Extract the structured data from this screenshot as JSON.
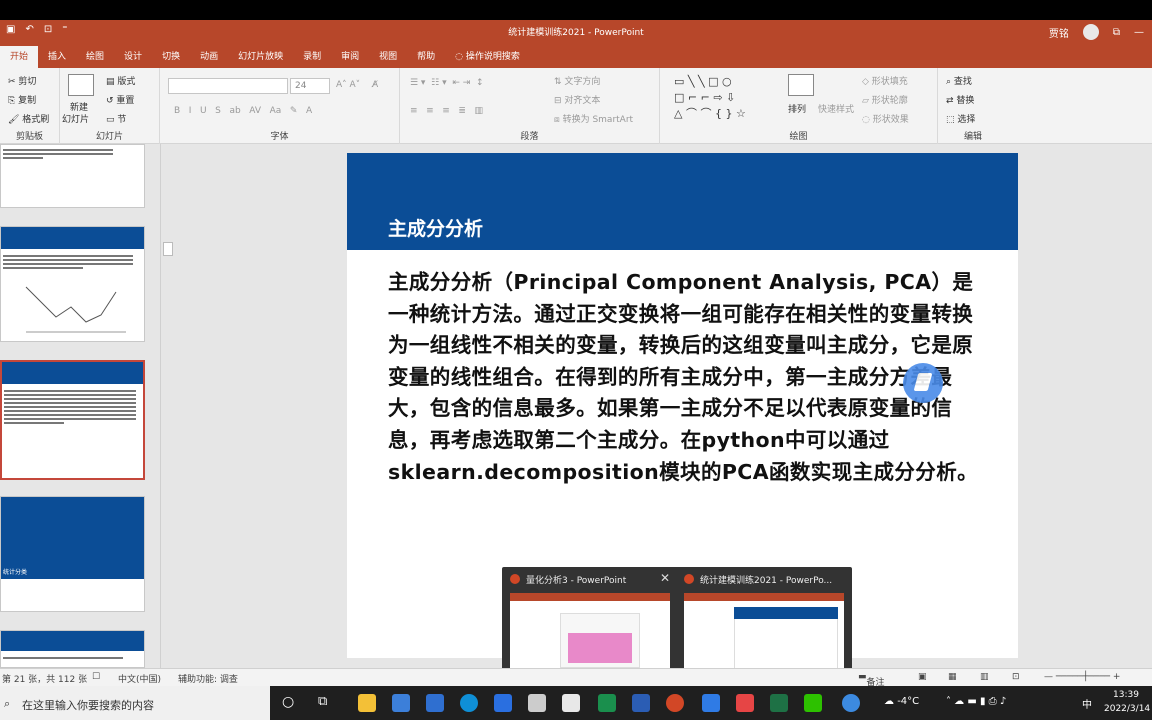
{
  "app": {
    "window_title": "统计建模训练2021 - PowerPoint",
    "user_name": "贾铭",
    "colors": {
      "ribbon_accent": "#b7472a",
      "slide_band": "#0b4d96"
    }
  },
  "tabs": [
    "开始",
    "插入",
    "绘图",
    "设计",
    "切换",
    "动画",
    "幻灯片放映",
    "录制",
    "审阅",
    "视图",
    "帮助",
    "操作说明搜索"
  ],
  "ribbon": {
    "clipboard": {
      "cut": "剪切",
      "copy": "复制",
      "format_painter": "格式刷",
      "label": "剪贴板"
    },
    "slides": {
      "new_slide_l1": "新建",
      "new_slide_l2": "幻灯片",
      "layout": "版式",
      "reset": "重置",
      "section": "节",
      "label": "幻灯片"
    },
    "font": {
      "font_size": "24",
      "label": "字体"
    },
    "paragraph": {
      "text_direction": "文字方向",
      "align_text": "对齐文本",
      "smartart": "转换为 SmartArt",
      "label": "段落"
    },
    "drawing": {
      "arrange": "排列",
      "quick_styles": "快速样式",
      "shape_fill": "形状填充",
      "shape_outline": "形状轮廓",
      "shape_effects": "形状效果",
      "label": "绘图"
    },
    "editing": {
      "find": "查找",
      "replace": "替换",
      "select": "选择",
      "label": "编辑"
    }
  },
  "slide": {
    "title": "主成分分析",
    "body": "主成分分析（Principal Component Analysis, PCA）是一种统计方法。通过正交变换将一组可能存在相关性的变量转换为一组线性不相关的变量，转换后的这组变量叫主成分，它是原变量的线性组合。在得到的所有主成分中，第一主成分方差最大，包含的信息最多。如果第一主成分不足以代表原变量的信息，再考虑选取第二个主成分。在python中可以通过sklearn.decomposition模块的PCA函数实现主成分分析。"
  },
  "thumbnails": {
    "t3_title": "统计分类"
  },
  "taskbar_popup": {
    "window1": "量化分析3 - PowerPoint",
    "window2": "统计建模训练2021 - PowerPo..."
  },
  "status": {
    "slide_count": "第 21 张，共 112 张",
    "language": "中文(中国)",
    "accessibility": "辅助功能: 调查",
    "notes": "备注"
  },
  "taskbar": {
    "search_placeholder": "在这里输入你要搜索的内容",
    "weather": "-4°C",
    "ime": "中",
    "time": "13:39",
    "date": "2022/3/14"
  }
}
